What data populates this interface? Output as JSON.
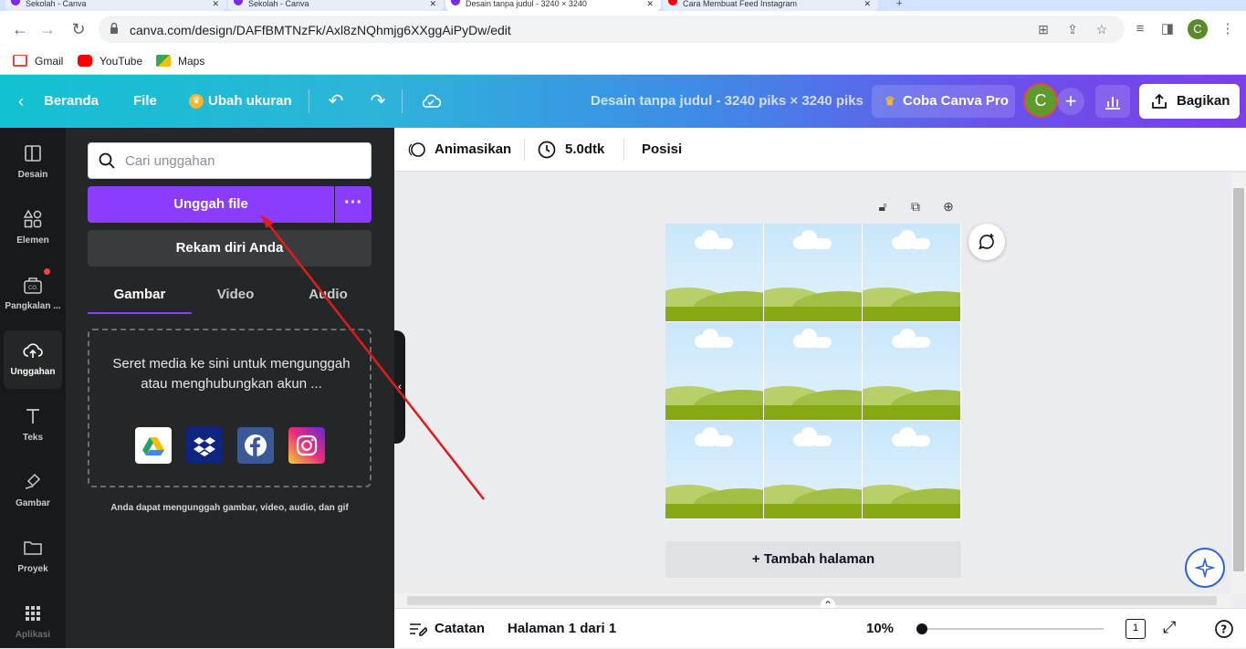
{
  "browser": {
    "tabs": [
      {
        "label": "Sekolah - Canva"
      },
      {
        "label": "Sekolah - Canva"
      },
      {
        "label": "Desain tanpa judul - 3240 × 3240"
      },
      {
        "label": "Cara Membuat Feed Instagram"
      }
    ],
    "url": "canva.com/design/DAFfBMTNzFk/Axl8zNQhmjg6XXggAiPyDw/edit",
    "profile_initial": "C",
    "bookmarks": [
      {
        "label": "Gmail"
      },
      {
        "label": "YouTube"
      },
      {
        "label": "Maps"
      }
    ]
  },
  "topbar": {
    "home_label": "Beranda",
    "file_label": "File",
    "resize_label": "Ubah ukuran",
    "doc_title": "Desain tanpa judul - 3240 piks × 3240 piks",
    "pro_label": "Coba Canva Pro",
    "avatar_initial": "C",
    "share_label": "Bagikan"
  },
  "rail": {
    "items": [
      {
        "label": "Desain"
      },
      {
        "label": "Elemen"
      },
      {
        "label": "Pangkalan ..."
      },
      {
        "label": "Unggahan"
      },
      {
        "label": "Teks"
      },
      {
        "label": "Gambar"
      },
      {
        "label": "Proyek"
      },
      {
        "label": "Aplikasi"
      }
    ]
  },
  "panel": {
    "search_placeholder": "Cari unggahan",
    "upload_label": "Unggah file",
    "record_label": "Rekam diri Anda",
    "tabs": [
      {
        "label": "Gambar"
      },
      {
        "label": "Video"
      },
      {
        "label": "Audio"
      }
    ],
    "dropzone_text": "Seret media ke sini untuk mengunggah atau menghubungkan akun ...",
    "hint": "Anda dapat mengunggah gambar, video, audio, dan gif"
  },
  "context_bar": {
    "animate_label": "Animasikan",
    "duration_label": "5.0dtk",
    "position_label": "Posisi"
  },
  "canvas": {
    "add_page_label": "+ Tambah halaman"
  },
  "footer": {
    "notes_label": "Catatan",
    "page_label": "Halaman 1 dari 1",
    "zoom_label": "10%",
    "page_count": "1"
  },
  "colors": {
    "accent_purple": "#8b3dff",
    "annotation_red": "#e01b1b"
  }
}
